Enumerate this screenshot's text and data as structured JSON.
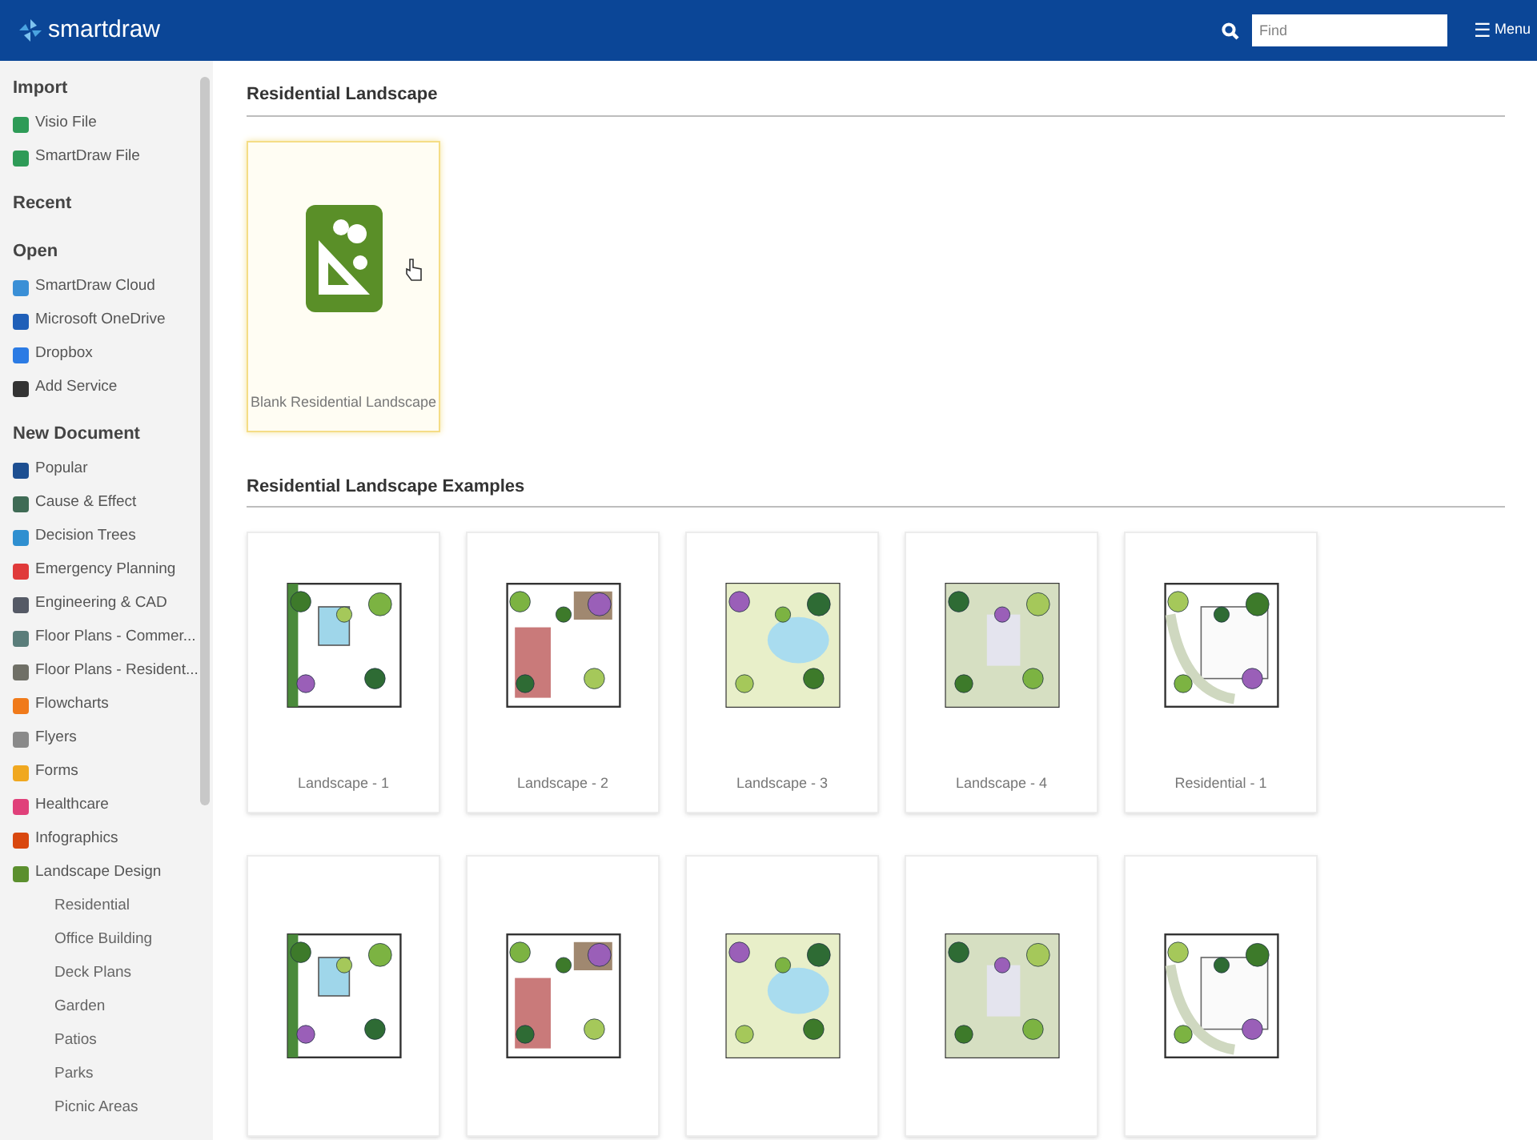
{
  "header": {
    "brand": "smartdraw",
    "search": {
      "placeholder": "Find"
    },
    "menu": {
      "icon": "☰",
      "label": "Menu"
    }
  },
  "sidebar": {
    "sections": [
      {
        "title": "Import",
        "items": [
          {
            "label": "Visio File",
            "color": "#2e9b57"
          },
          {
            "label": "SmartDraw File",
            "color": "#2e9b57"
          }
        ]
      },
      {
        "title": "Recent"
      },
      {
        "title": "Open",
        "items": [
          {
            "label": "SmartDraw Cloud",
            "color": "#3a8fd6"
          },
          {
            "label": "Microsoft OneDrive",
            "color": "#1f5fb8"
          },
          {
            "label": "Dropbox",
            "color": "#2b7be4"
          },
          {
            "label": "Add Service",
            "color": "#333333"
          }
        ]
      },
      {
        "title": "New Document",
        "items": [
          {
            "label": "Popular",
            "color": "#1d4f91"
          },
          {
            "label": "Cause & Effect",
            "color": "#3f6b55"
          },
          {
            "label": "Decision Trees",
            "color": "#2f8fd0"
          },
          {
            "label": "Emergency Planning",
            "color": "#e03a3a"
          },
          {
            "label": "Engineering & CAD",
            "color": "#555a66"
          },
          {
            "label": "Floor Plans - Commer...",
            "color": "#5a7d7a"
          },
          {
            "label": "Floor Plans - Resident...",
            "color": "#6f6f66"
          },
          {
            "label": "Flowcharts",
            "color": "#f07a1a"
          },
          {
            "label": "Flyers",
            "color": "#8a8a8a"
          },
          {
            "label": "Forms",
            "color": "#f0a820"
          },
          {
            "label": "Healthcare",
            "color": "#e0407a"
          },
          {
            "label": "Infographics",
            "color": "#d9480f"
          },
          {
            "label": "Landscape Design",
            "color": "#5b8f2e",
            "children": [
              {
                "label": "Residential"
              },
              {
                "label": "Office Building"
              },
              {
                "label": "Deck Plans"
              },
              {
                "label": "Garden"
              },
              {
                "label": "Patios"
              },
              {
                "label": "Parks"
              },
              {
                "label": "Picnic Areas"
              }
            ]
          }
        ]
      }
    ]
  },
  "main": {
    "sections": [
      {
        "title": "Residential Landscape",
        "kind": "blank",
        "cards": [
          {
            "label": "Blank Residential Landscape",
            "selected": true
          }
        ]
      },
      {
        "title": "Residential Landscape Examples",
        "kind": "examples",
        "cards": [
          {
            "label": "Landscape - 1",
            "selected": false
          },
          {
            "label": "Landscape - 2",
            "selected": false
          },
          {
            "label": "Landscape - 3",
            "selected": false
          },
          {
            "label": "Landscape - 4",
            "selected": false
          },
          {
            "label": "Residential - 1",
            "selected": false
          },
          {
            "selected": false
          },
          {
            "selected": false
          },
          {
            "selected": false
          },
          {
            "selected": false
          },
          {
            "selected": false
          }
        ]
      }
    ]
  }
}
